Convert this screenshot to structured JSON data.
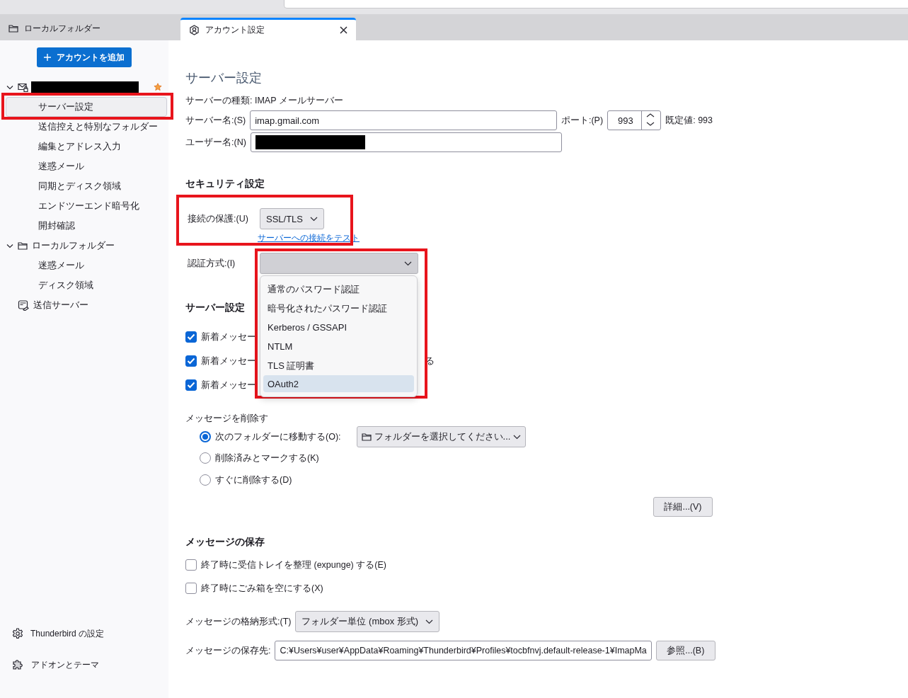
{
  "tabs": [
    {
      "label": "ローカルフォルダー",
      "selected": false,
      "closable": false
    },
    {
      "label": "アカウント設定",
      "selected": true,
      "closable": true
    }
  ],
  "sidebar": {
    "add_account_button": "アカウントを追加",
    "tree": [
      {
        "kind": "account",
        "redacted": true,
        "expanded": true,
        "default": true,
        "children": [
          {
            "label": "サーバー設定",
            "selected": true,
            "highlighted": true
          },
          {
            "label": "送信控えと特別なフォルダー",
            "selected": false,
            "highlighted": false
          },
          {
            "label": "編集とアドレス入力",
            "selected": false,
            "highlighted": false
          },
          {
            "label": "迷惑メール",
            "selected": false,
            "highlighted": false
          },
          {
            "label": "同期とディスク領域",
            "selected": false,
            "highlighted": false
          },
          {
            "label": "エンドツーエンド暗号化",
            "selected": false,
            "highlighted": false
          },
          {
            "label": "開封確認",
            "selected": false,
            "highlighted": false
          }
        ]
      },
      {
        "kind": "folder",
        "label": "ローカルフォルダー",
        "expanded": true,
        "children": [
          {
            "label": "迷惑メール",
            "selected": false,
            "highlighted": false
          },
          {
            "label": "ディスク領域",
            "selected": false,
            "highlighted": false
          }
        ]
      },
      {
        "kind": "server",
        "label": "送信サーバー"
      }
    ],
    "footer": [
      {
        "kind": "gear",
        "label": "Thunderbird の設定"
      },
      {
        "kind": "puzzle",
        "label": "アドオンとテーマ"
      }
    ]
  },
  "content": {
    "title": "サーバー設定",
    "server_type": "サーバーの種類: IMAP メールサーバー",
    "server_name": {
      "label": "サーバー名:(S)",
      "value": "imap.gmail.com"
    },
    "port": {
      "label": "ポート:(P)",
      "value": "993",
      "default_text": "既定値: 993"
    },
    "user_name": {
      "label": "ユーザー名:(N)",
      "redacted": true
    },
    "security": {
      "heading": "セキュリティ設定",
      "highlighted": true,
      "connection_label": "接続の保護:(U)",
      "connection_value": "SSL/TLS",
      "test_link": "サーバーへの接続をテスト"
    },
    "auth": {
      "label": "認証方式:(I)",
      "highlighted": true,
      "expanded": true,
      "options": [
        {
          "label": "通常のパスワード認証",
          "selected": false
        },
        {
          "label": "暗号化されたパスワード認証",
          "selected": false
        },
        {
          "label": "Kerberos / GSSAPI",
          "selected": false
        },
        {
          "label": "NTLM",
          "selected": false
        },
        {
          "label": "TLS 証明書",
          "selected": false
        },
        {
          "label": "OAuth2",
          "selected": true
        }
      ]
    },
    "server_settings": {
      "heading": "サーバー設定",
      "checkboxes": [
        {
          "label": "新着メッセー",
          "checked": true
        },
        {
          "label": "新着メッセー",
          "checked": true,
          "tail": "る"
        },
        {
          "label": "新着メッセー",
          "checked": true
        }
      ],
      "delete_label": "メッセージを削除す",
      "radios": [
        {
          "label": "次のフォルダーに移動する(O):",
          "selected": true,
          "folder_picker": "フォルダーを選択してください..."
        },
        {
          "label": "削除済みとマークする(K)",
          "selected": false
        },
        {
          "label": "すぐに削除する(D)",
          "selected": false
        }
      ],
      "advanced_button": "詳細...(V)"
    },
    "storage": {
      "heading": "メッセージの保存",
      "checkboxes": [
        {
          "label": "終了時に受信トレイを整理 (expunge) する(E)",
          "checked": false
        },
        {
          "label": "終了時にごみ箱を空にする(X)",
          "checked": false
        }
      ],
      "format_label": "メッセージの格納形式:(T)",
      "format_value": "フォルダー単位 (mbox 形式)",
      "path_label": "メッセージの保存先:",
      "path_value": "C:¥Users¥user¥AppData¥Roaming¥Thunderbird¥Profiles¥tocbfnvj.default-release-1¥ImapMa",
      "browse_button": "参照...(B)"
    }
  }
}
